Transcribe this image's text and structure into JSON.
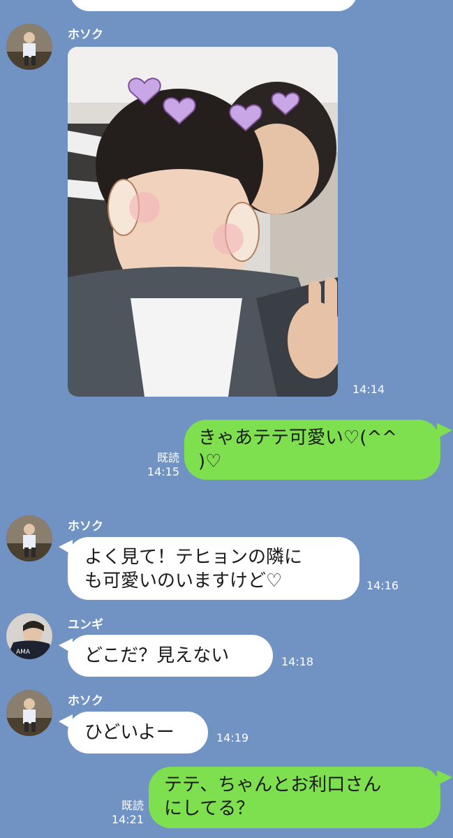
{
  "colors": {
    "background": "#7093c4",
    "incoming_bubble": "#ffffff",
    "outgoing_bubble": "#7ee04f",
    "meta_text": "#ffffff"
  },
  "messages": [
    {
      "sender": "ホソク",
      "type": "image",
      "image_alt": "selfie-photo",
      "time": "14:14"
    },
    {
      "sender": "me",
      "type": "text",
      "lines": [
        "きゃあテテ可愛い♡(^^",
        ")♡"
      ],
      "read_label": "既読",
      "time": "14:15"
    },
    {
      "sender": "ホソク",
      "type": "text",
      "lines": [
        "よく見て！テヒョンの隣に",
        "も可愛いのいますけど♡"
      ],
      "time": "14:16"
    },
    {
      "sender": "ユンギ",
      "type": "text",
      "lines": [
        "どこだ？見えない"
      ],
      "time": "14:18"
    },
    {
      "sender": "ホソク",
      "type": "text",
      "lines": [
        "ひどいよー"
      ],
      "time": "14:19"
    },
    {
      "sender": "me",
      "type": "text",
      "lines": [
        "テテ、ちゃんとお利口さん",
        "にしてる？"
      ],
      "read_label": "既読",
      "time": "14:21"
    }
  ]
}
